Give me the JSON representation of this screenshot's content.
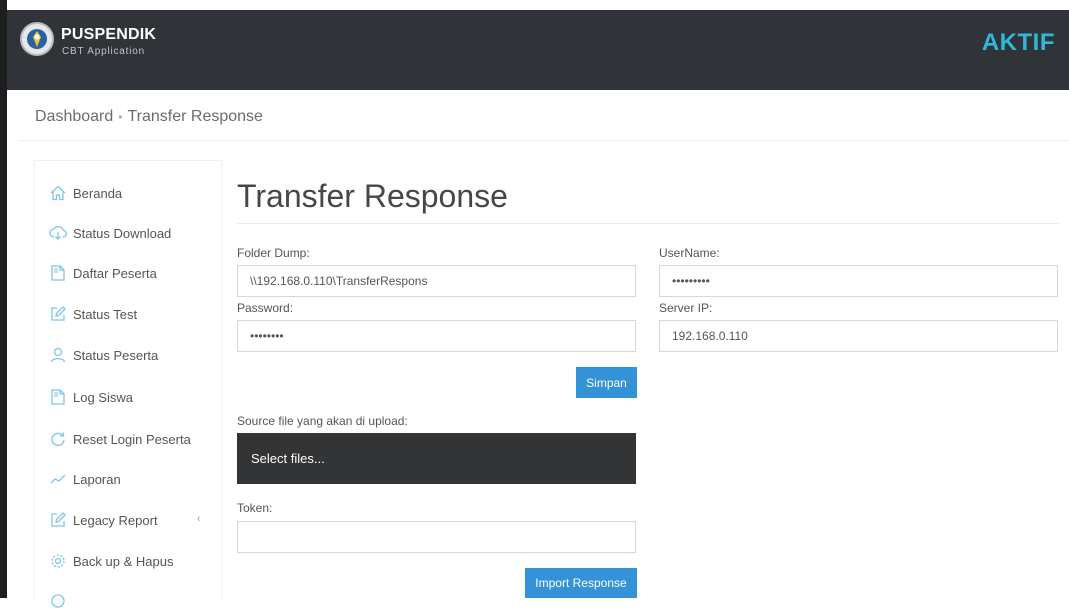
{
  "header": {
    "logo_title": "PUSPENDIK",
    "logo_subtitle": "CBT Application",
    "status": "AKTIF"
  },
  "breadcrumb": {
    "home": "Dashboard",
    "separator": "•",
    "current": "Transfer Response"
  },
  "sidebar": {
    "items": [
      {
        "label": "Beranda",
        "icon": "home-icon"
      },
      {
        "label": "Status Download",
        "icon": "cloud-download-icon"
      },
      {
        "label": "Daftar Peserta",
        "icon": "document-icon"
      },
      {
        "label": "Status Test",
        "icon": "edit-icon"
      },
      {
        "label": "Status Peserta",
        "icon": "user-icon"
      },
      {
        "label": "Log Siswa",
        "icon": "document-icon"
      },
      {
        "label": "Reset Login Peserta",
        "icon": "refresh-icon"
      },
      {
        "label": "Laporan",
        "icon": "chart-line-icon"
      },
      {
        "label": "Legacy Report",
        "icon": "edit-icon",
        "chevron": "‹"
      },
      {
        "label": "Back up & Hapus",
        "icon": "gear-icon"
      }
    ]
  },
  "main": {
    "title": "Transfer Response",
    "folder_dump": {
      "label": "Folder Dump:",
      "value": "\\\\192.168.0.110\\TransferRespons"
    },
    "username": {
      "label": "UserName:",
      "value": "•••••••••"
    },
    "password": {
      "label": "Password:",
      "value": "••••••••"
    },
    "server_ip": {
      "label": "Server IP:",
      "value": "192.168.0.110"
    },
    "save_button": "Simpan",
    "source_file": {
      "label": "Source file yang akan di upload:",
      "button": "Select files..."
    },
    "token": {
      "label": "Token:",
      "value": ""
    },
    "import_button": "Import Response"
  },
  "colors": {
    "topbar": "#303338",
    "accent": "#32b7d6",
    "button": "#3493d6",
    "sidebar_icon": "#7dc5ea"
  }
}
